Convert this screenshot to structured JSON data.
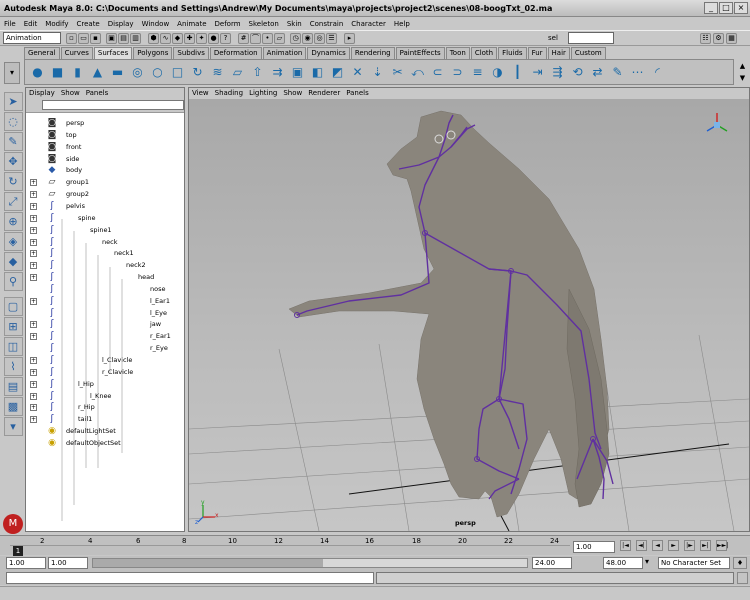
{
  "window": {
    "title": "Autodesk Maya 8.0: C:\\Documents and Settings\\Andrew\\My Documents\\maya\\projects\\project2\\scenes\\08-boogTxt_02.ma",
    "buttons": [
      "_",
      "□",
      "×"
    ]
  },
  "menu": [
    "File",
    "Edit",
    "Modify",
    "Create",
    "Display",
    "Window",
    "Animate",
    "Deform",
    "Skeleton",
    "Skin",
    "Constrain",
    "Character",
    "Help"
  ],
  "status": {
    "mode": "Animation",
    "selection_field": "sel",
    "selection_value": ""
  },
  "shelf_tabs": [
    "General",
    "Curves",
    "Surfaces",
    "Polygons",
    "Subdivs",
    "Deformation",
    "Animation",
    "Dynamics",
    "Rendering",
    "PaintEffects",
    "Toon",
    "Cloth",
    "Fluids",
    "Fur",
    "Hair",
    "Custom"
  ],
  "shelf_active": "Surfaces",
  "outliner": {
    "menu": [
      "Display",
      "Show",
      "Panels"
    ],
    "items": [
      {
        "label": "persp",
        "depth": 0,
        "icon": "camera",
        "expand": false
      },
      {
        "label": "top",
        "depth": 0,
        "icon": "camera",
        "expand": false
      },
      {
        "label": "front",
        "depth": 0,
        "icon": "camera",
        "expand": false
      },
      {
        "label": "side",
        "depth": 0,
        "icon": "camera",
        "expand": false
      },
      {
        "label": "body",
        "depth": 0,
        "icon": "mesh",
        "expand": false
      },
      {
        "label": "group1",
        "depth": 0,
        "icon": "group",
        "expand": true
      },
      {
        "label": "group2",
        "depth": 0,
        "icon": "group",
        "expand": true
      },
      {
        "label": "pelvis",
        "depth": 0,
        "icon": "joint",
        "expand": true
      },
      {
        "label": "spine",
        "depth": 1,
        "icon": "joint",
        "expand": true
      },
      {
        "label": "spine1",
        "depth": 2,
        "icon": "joint",
        "expand": true
      },
      {
        "label": "neck",
        "depth": 3,
        "icon": "joint",
        "expand": true
      },
      {
        "label": "neck1",
        "depth": 4,
        "icon": "joint",
        "expand": true
      },
      {
        "label": "neck2",
        "depth": 5,
        "icon": "joint",
        "expand": true
      },
      {
        "label": "head",
        "depth": 6,
        "icon": "joint",
        "expand": true
      },
      {
        "label": "nose",
        "depth": 7,
        "icon": "joint",
        "expand": false
      },
      {
        "label": "l_Ear1",
        "depth": 7,
        "icon": "joint",
        "expand": true
      },
      {
        "label": "l_Eye",
        "depth": 7,
        "icon": "joint",
        "expand": false
      },
      {
        "label": "jaw",
        "depth": 7,
        "icon": "joint",
        "expand": true
      },
      {
        "label": "r_Ear1",
        "depth": 7,
        "icon": "joint",
        "expand": true
      },
      {
        "label": "r_Eye",
        "depth": 7,
        "icon": "joint",
        "expand": false
      },
      {
        "label": "l_Clavicle",
        "depth": 3,
        "icon": "joint",
        "expand": true
      },
      {
        "label": "r_Clavicle",
        "depth": 3,
        "icon": "joint",
        "expand": true
      },
      {
        "label": "l_Hip",
        "depth": 1,
        "icon": "joint",
        "expand": true
      },
      {
        "label": "l_Knee",
        "depth": 2,
        "icon": "joint",
        "expand": true
      },
      {
        "label": "r_Hip",
        "depth": 1,
        "icon": "joint",
        "expand": true
      },
      {
        "label": "tail1",
        "depth": 1,
        "icon": "joint",
        "expand": true
      },
      {
        "label": "defaultLightSet",
        "depth": 0,
        "icon": "set",
        "expand": false
      },
      {
        "label": "defaultObjectSet",
        "depth": 0,
        "icon": "set",
        "expand": false
      }
    ]
  },
  "viewport": {
    "menu": [
      "View",
      "Shading",
      "Lighting",
      "Show",
      "Renderer",
      "Panels"
    ],
    "camera_label": "persp",
    "axis_labels": [
      "x",
      "y",
      "z"
    ]
  },
  "timeline": {
    "ticks": [
      "1",
      "2",
      "4",
      "6",
      "8",
      "10",
      "12",
      "14",
      "16",
      "18",
      "20",
      "22",
      "24"
    ],
    "current_frame": "1",
    "current_field": "1.00",
    "play_buttons": [
      "|◄",
      "◄|",
      "◄",
      "►",
      "|►",
      "►|",
      "►►|"
    ]
  },
  "range": {
    "start": "1.00",
    "start_inner": "1.00",
    "end_inner": "24.00",
    "end": "48.00",
    "character_set": "No Character Set"
  },
  "colors": {
    "joint": "#6030a0",
    "mesh": "#8a857c",
    "icon_blue": "#1a6aa8"
  }
}
